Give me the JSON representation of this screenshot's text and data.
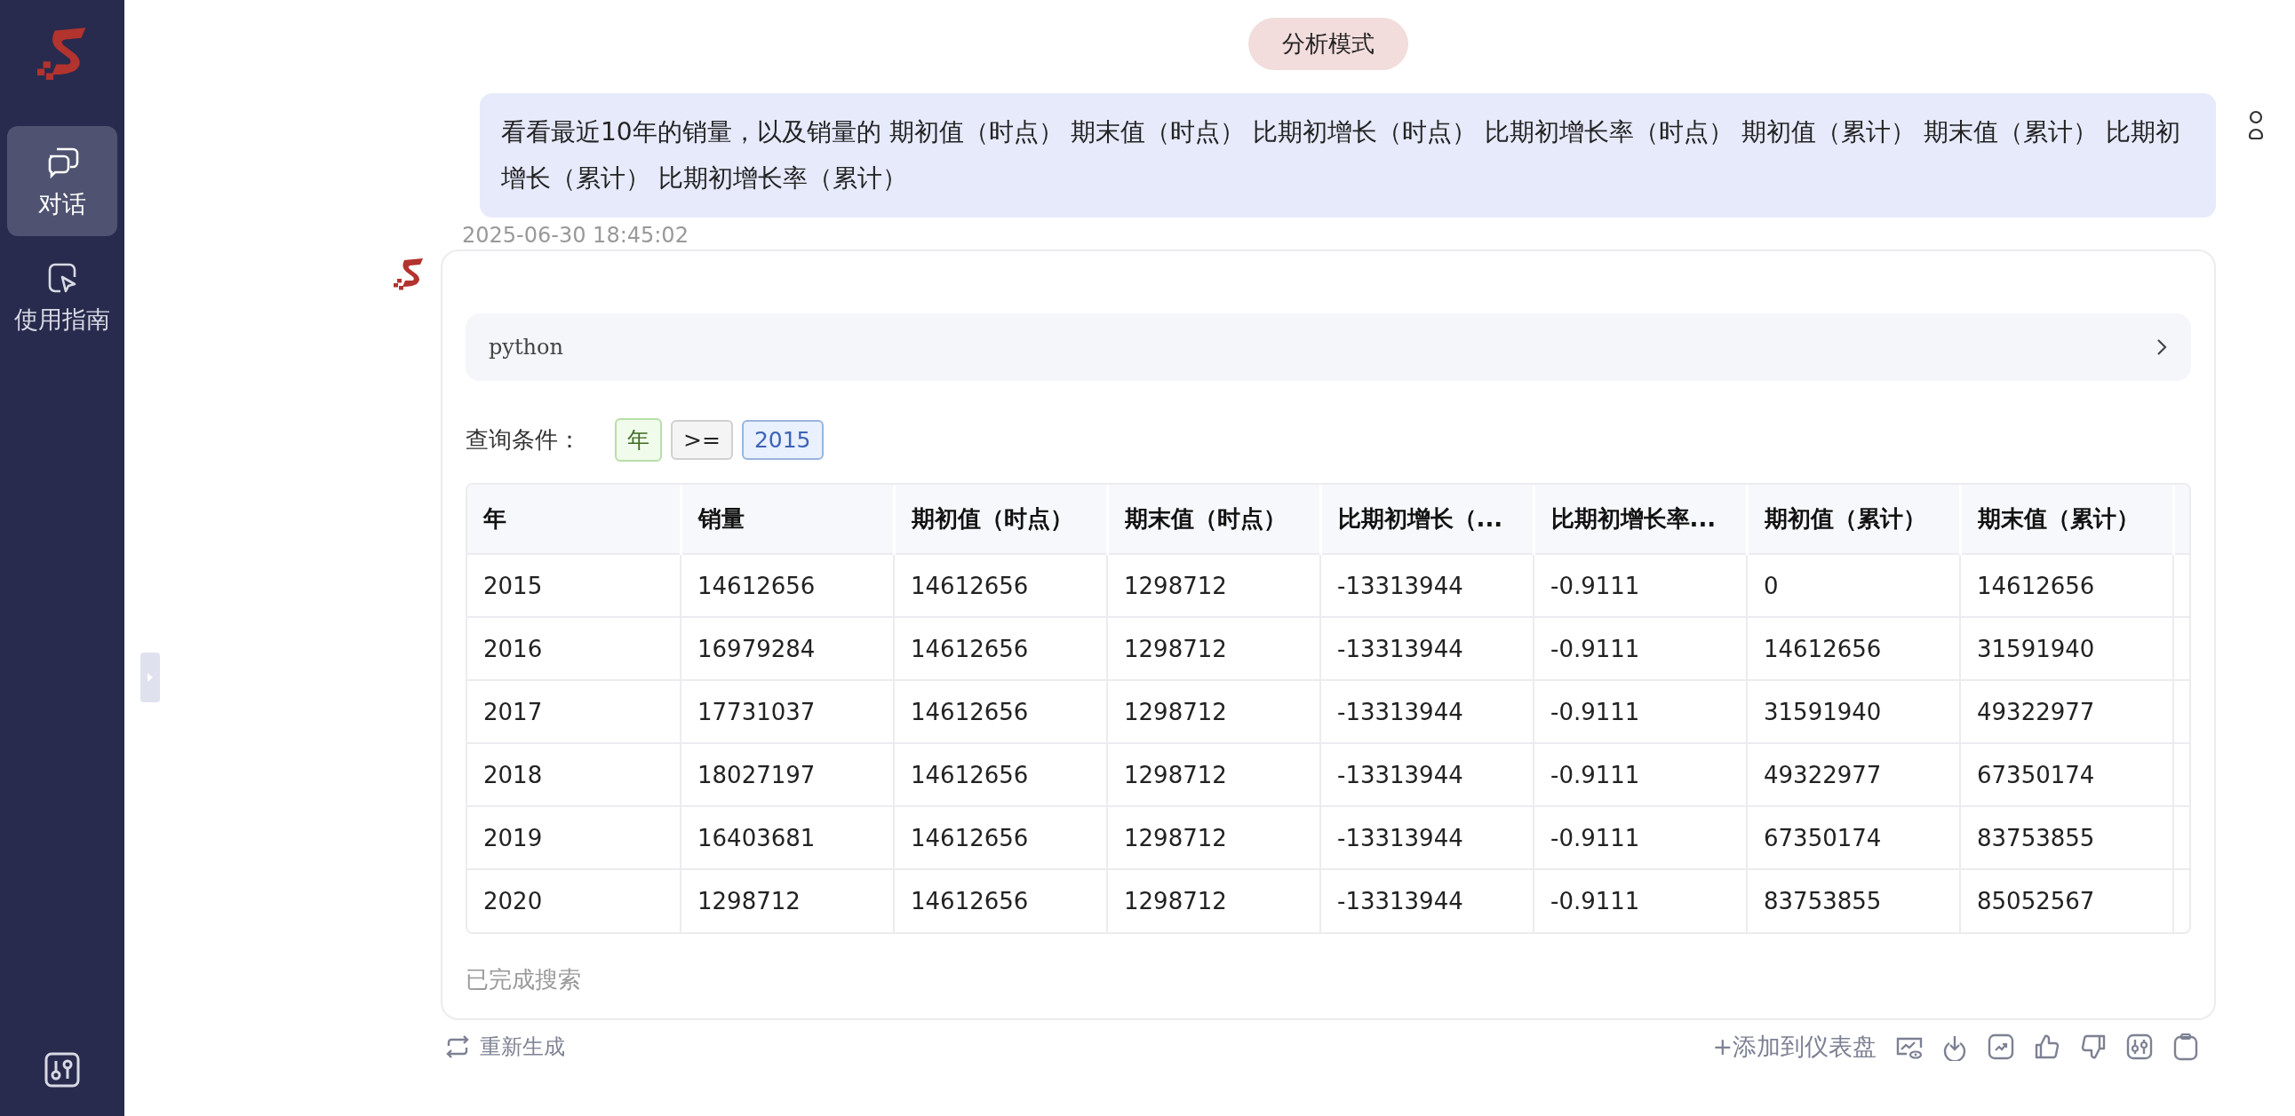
{
  "sidebar": {
    "items": [
      {
        "label": "对话",
        "selected": true
      },
      {
        "label": "使用指南",
        "selected": false
      }
    ]
  },
  "mode_badge": "分析模式",
  "user_message": {
    "text": "看看最近10年的销量，以及销量的 期初值（时点） 期末值（时点） 比期初增长（时点） 比期初增长率（时点） 期初值（累计） 期末值（累计） 比期初增长（累计） 比期初增长率（累计）",
    "timestamp": "2025-06-30 18:45:02"
  },
  "answer": {
    "code_block": {
      "language": "python",
      "expanded": false
    },
    "query": {
      "label": "查询条件：",
      "tags": [
        {
          "text": "年",
          "kind": "field"
        },
        {
          "text": ">=",
          "kind": "operator"
        },
        {
          "text": "2015",
          "kind": "value"
        }
      ]
    },
    "table": {
      "columns": [
        "年",
        "销量",
        "期初值（时点）",
        "期末值（时点）",
        "比期初增长（...",
        "比期初增长率...",
        "期初值（累计）",
        "期末值（累计）"
      ],
      "rows": [
        [
          "2015",
          "14612656",
          "14612656",
          "1298712",
          "-13313944",
          "-0.9111",
          "0",
          "14612656"
        ],
        [
          "2016",
          "16979284",
          "14612656",
          "1298712",
          "-13313944",
          "-0.9111",
          "14612656",
          "31591940"
        ],
        [
          "2017",
          "17731037",
          "14612656",
          "1298712",
          "-13313944",
          "-0.9111",
          "31591940",
          "49322977"
        ],
        [
          "2018",
          "18027197",
          "14612656",
          "1298712",
          "-13313944",
          "-0.9111",
          "49322977",
          "67350174"
        ],
        [
          "2019",
          "16403681",
          "14612656",
          "1298712",
          "-13313944",
          "-0.9111",
          "67350174",
          "83753855"
        ],
        [
          "2020",
          "1298712",
          "14612656",
          "1298712",
          "-13313944",
          "-0.9111",
          "83753855",
          "85052567"
        ]
      ]
    },
    "status": "已完成搜索"
  },
  "regenerate": "重新生成",
  "add_to_dashboard": "+添加到仪表盘"
}
